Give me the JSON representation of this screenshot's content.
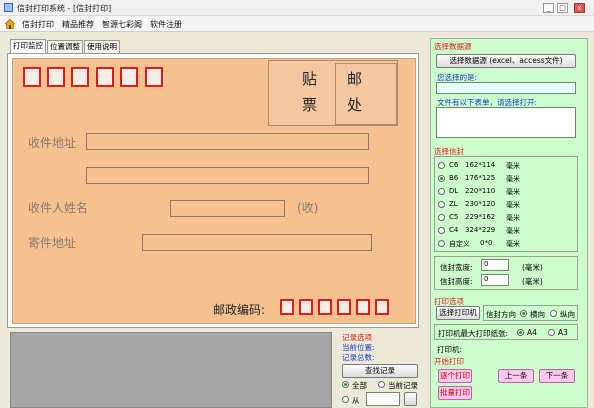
{
  "window": {
    "title": "信封打印系统 - [信封打印]",
    "minimize": "_",
    "maximize": "□",
    "close": "x"
  },
  "menu": [
    {
      "label": "信封打印"
    },
    {
      "label": "精品推荐"
    },
    {
      "label": "智源七彩阁"
    },
    {
      "label": "软件注册"
    }
  ],
  "tabs": [
    {
      "label": "打印监控",
      "active": true
    },
    {
      "label": "位置调整",
      "active": false
    },
    {
      "label": "使用说明",
      "active": false
    }
  ],
  "envelope": {
    "stamp_label_1": "贴",
    "stamp_label_2": "票",
    "postal_label_1": "邮",
    "postal_label_2": "处",
    "recipient_address_label": "收件地址",
    "recipient_name_label": "收件人姓名",
    "recipient_suffix": "(收)",
    "sender_address_label": "寄件地址",
    "sender_zip_label": "邮政编码:"
  },
  "records": {
    "title": "记录选项",
    "current_position_label": "当前位置:",
    "total_label": "记录总数:",
    "find_button": "查找记录",
    "all_option": "全部",
    "current_option": "当前记录",
    "from_option": "从",
    "selected": "全部"
  },
  "data_source": {
    "title": "选择数据源",
    "select_button": "选择数据源 (excel、access文件)",
    "selected_label": "您选择的是:",
    "selected_value": "",
    "sheets_label": "文件有以下表单，请选择打开:"
  },
  "envelope_select": {
    "title": "选择信封",
    "unit": "毫米",
    "options": [
      {
        "code": "C6",
        "size": "162*114",
        "unit": "毫米",
        "selected": false
      },
      {
        "code": "B6",
        "size": "176*125",
        "unit": "毫米",
        "selected": true
      },
      {
        "code": "DL",
        "size": "220*110",
        "unit": "毫米",
        "selected": false
      },
      {
        "code": "ZL",
        "size": "230*120",
        "unit": "毫米",
        "selected": false
      },
      {
        "code": "C5",
        "size": "229*162",
        "unit": "毫米",
        "selected": false
      },
      {
        "code": "C4",
        "size": "324*229",
        "unit": "毫米",
        "selected": false
      },
      {
        "code": "自定义",
        "size": "0*0",
        "unit": "毫米",
        "selected": false
      }
    ],
    "width_label": "信封宽度:",
    "width_value": "0",
    "width_unit": "(毫米)",
    "height_label": "信封高度:",
    "height_value": "0",
    "height_unit": "(毫米)"
  },
  "print_options": {
    "title": "打印选项",
    "select_printer_button": "选择打印机",
    "direction_label": "信封方向",
    "portrait": "横向",
    "landscape": "纵向",
    "direction_selected": "横向",
    "max_paper_label": "打印机最大打印纸张:",
    "a4": "A4",
    "a3": "A3",
    "paper_selected": "A4",
    "printer_label": "打印机:"
  },
  "start_print": {
    "title": "开始打印",
    "print_one": "逐个打印",
    "prev": "上一条",
    "next": "下一条",
    "batch_print": "批量打印"
  },
  "colors": {
    "envelope": "#f5c191",
    "zip_border": "#e01b1b",
    "right_panel": "#cdfccd",
    "section_title": "#e01b1b",
    "pink_button": "#ffc8f0",
    "preview": "#a6a6a6"
  }
}
